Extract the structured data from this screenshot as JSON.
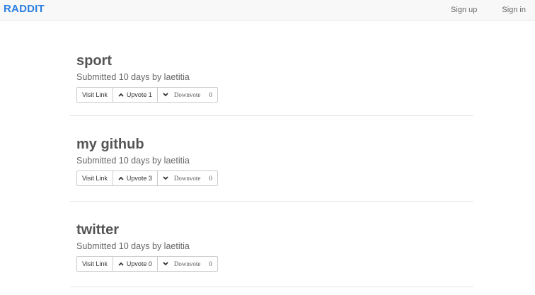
{
  "navbar": {
    "brand": "RADDIT",
    "signup": "Sign up",
    "signin": "Sign in"
  },
  "posts": [
    {
      "title": "sport",
      "meta": "Submitted 10 days by laetitia",
      "visit_label": "Visit Link",
      "upvote_label": "Upvote 1",
      "downvote_label": "Downvote",
      "downvote_count": "0"
    },
    {
      "title": "my github",
      "meta": "Submitted 10 days by laetitia",
      "visit_label": "Visit Link",
      "upvote_label": "Upvote 3",
      "downvote_label": "Downvote",
      "downvote_count": "0"
    },
    {
      "title": "twitter",
      "meta": "Submitted 10 days by laetitia",
      "visit_label": "Visit Link",
      "upvote_label": "Upvote 0",
      "downvote_label": "Downvote",
      "downvote_count": "0"
    }
  ]
}
